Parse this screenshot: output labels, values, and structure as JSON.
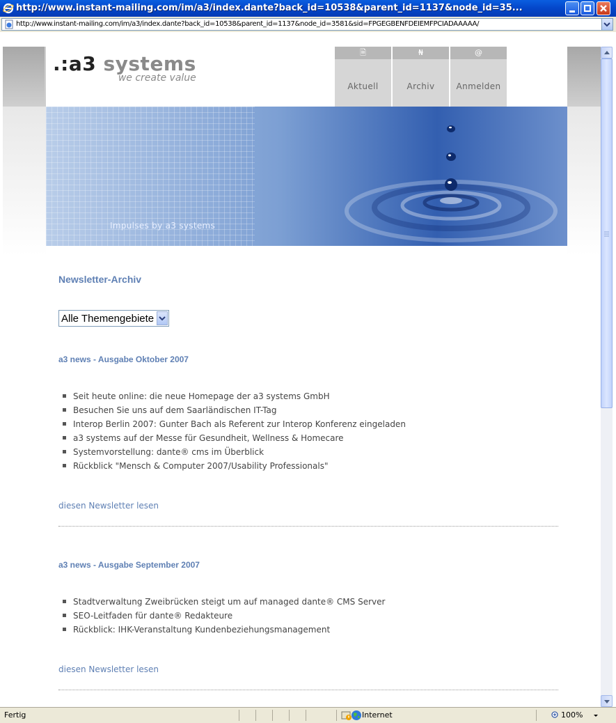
{
  "window": {
    "title": "http://www.instant-mailing.com/im/a3/index.dante?back_id=10538&parent_id=1137&node_id=35..."
  },
  "address_bar": {
    "url": "http://www.instant-mailing.com/im/a3/index.dante?back_id=10538&parent_id=1137&node_id=3581&sid=FPGEGBENFDEIEMFPCIADAAAAA/"
  },
  "site": {
    "logo_prefix": ".:a3",
    "logo_suffix": "systems",
    "tagline": "we create value",
    "nav": [
      {
        "label": "Aktuell",
        "icon": "document-icon",
        "glyph": "🗎"
      },
      {
        "label": "Archiv",
        "icon": "binoculars-icon",
        "glyph": "₦"
      },
      {
        "label": "Anmelden",
        "icon": "at-icon",
        "glyph": "@"
      }
    ],
    "banner_caption": "Impulses by a3 systems"
  },
  "main": {
    "heading": "Newsletter-Archiv",
    "filter_selected": "Alle Themengebiete",
    "issues": [
      {
        "title": "a3 news - Ausgabe Oktober 2007",
        "items": [
          "Seit heute online: die neue Homepage der a3 systems GmbH",
          "Besuchen Sie uns auf dem Saarländischen  IT-Tag",
          "Interop Berlin 2007: Gunter Bach als Referent zur Interop Konferenz eingeladen",
          "a3 systems auf der Messe für Gesundheit, Wellness & Homecare",
          "Systemvorstellung:  dante® cms im Überblick",
          "Rückblick \"Mensch & Computer 2007/Usability Professionals\""
        ],
        "link": "diesen Newsletter lesen"
      },
      {
        "title": "a3 news - Ausgabe September 2007",
        "items": [
          "Stadtverwaltung Zweibrücken steigt um auf managed dante® CMS Server",
          "SEO-Leitfaden für dante® Redakteure",
          "Rückblick: IHK-Veranstaltung Kundenbeziehungsmanagement"
        ],
        "link": "diesen Newsletter lesen"
      }
    ]
  },
  "status_bar": {
    "status": "Fertig",
    "zone": "Internet",
    "zoom": "100%"
  }
}
